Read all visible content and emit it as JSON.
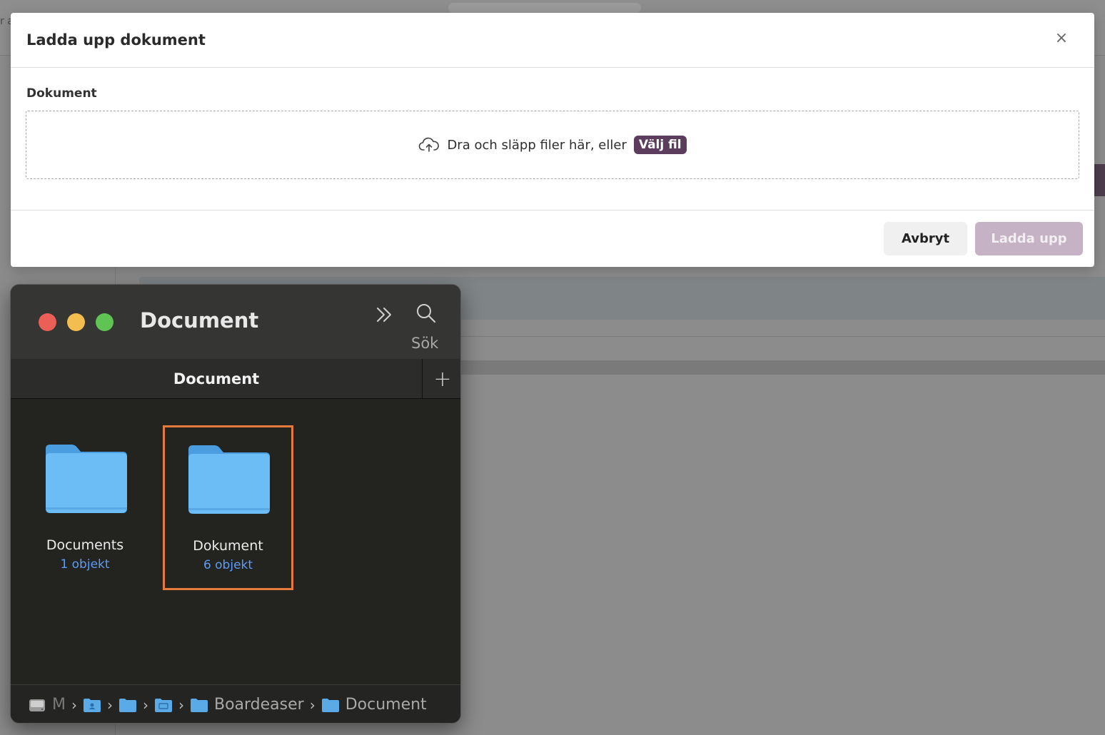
{
  "backdrop": {
    "cut_text": "r a"
  },
  "modal": {
    "title": "Ladda upp dokument",
    "close_symbol": "×",
    "field_label": "Dokument",
    "dropzone": {
      "icon": "cloud-upload-icon",
      "text": "Dra och släpp filer här, eller",
      "link_label": "Välj fil"
    },
    "cancel_label": "Avbryt",
    "upload_label": "Ladda upp",
    "colors": {
      "accent": "#5c3d5e",
      "upload_disabled": "#c5b2c4"
    }
  },
  "finder": {
    "title": "Document",
    "search_label": "Sök",
    "tab_label": "Document",
    "add_tab_symbol": "+",
    "items": [
      {
        "name": "Documents",
        "count": "1 objekt",
        "selected": false
      },
      {
        "name": "Dokument",
        "count": "6 objekt",
        "selected": true
      }
    ],
    "path": {
      "disk_label": "M",
      "segments": [
        "Boardeaser",
        "Document"
      ]
    },
    "colors": {
      "selection_border": "#e47b3a",
      "folder": "#6cbcf5",
      "count_text": "#5c9cf5"
    }
  }
}
